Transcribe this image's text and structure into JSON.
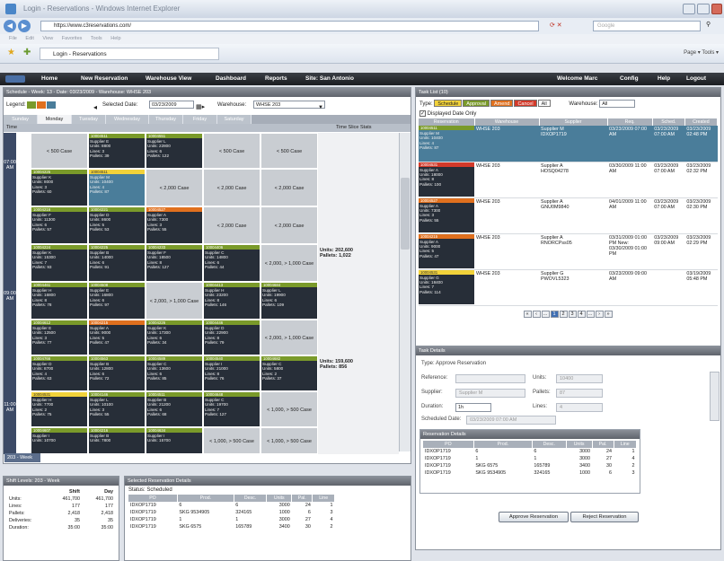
{
  "browser": {
    "title": "Login - Reservations - Windows Internet Explorer",
    "url": "https://www.c3reservations.com/",
    "search_placeholder": "Google",
    "menus": [
      "File",
      "Edit",
      "View",
      "Favorites",
      "Tools",
      "Help"
    ],
    "tab_label": "Login - Reservations",
    "tools": "Page ▾  Tools ▾"
  },
  "nav": {
    "home": "Home",
    "new_reservation": "New Reservation",
    "warehouse_view": "Warehouse View",
    "dashboard": "Dashboard",
    "reports": "Reports",
    "site": "Site: San Antonio",
    "welcome": "Welcome Marc",
    "config": "Config",
    "help": "Help",
    "logout": "Logout"
  },
  "schedule": {
    "header": "Schedule - Week: 13 - Date: 03/23/2009 - Warehouse: WHSE 203",
    "legend_label": "Legend:",
    "selected_date_label": "Selected Date:",
    "selected_date": "03/23/2009",
    "warehouse_label": "Warehouse:",
    "warehouse": "WHSE 203",
    "days": [
      "Sunday",
      "Monday",
      "Tuesday",
      "Wednesday",
      "Thursday",
      "Friday",
      "Saturday"
    ],
    "time_label": "Time",
    "stats_label": "Time Slice Stats",
    "week_button": "203 - Week",
    "times": [
      "07:00 AM",
      "09:00 AM",
      "11:00 AM"
    ],
    "empty": {
      "c500": "< 500 Case",
      "c2000": "< 2,000 Case",
      "c2000_1000": "< 2,000, > 1,000 Case",
      "c1000_500": "< 1,000, > 500 Case"
    },
    "stats": [
      {
        "units": "Units: 202,600",
        "pallets": "Pallets: 1,022"
      },
      {
        "units": "Units: 159,600",
        "pallets": "Pallets: 856"
      }
    ]
  },
  "shift": {
    "header": "Shift Levels: 203 - Week",
    "col1": "Shift",
    "col2": "Day",
    "rows": [
      [
        "Units:",
        "461,700",
        "461,700"
      ],
      [
        "Lines:",
        "177",
        "177"
      ],
      [
        "Pallets:",
        "2,418",
        "2,418"
      ],
      [
        "Deliveries:",
        "35",
        "35"
      ],
      [
        "Duration:",
        "35:00",
        "35:00"
      ]
    ]
  },
  "srd": {
    "header": "Selected Reservation Details",
    "status_label": "Status:",
    "status": "Scheduled",
    "cols": [
      "PO",
      "Prod.",
      "Desc.",
      "Units",
      "Pal.",
      "Line"
    ],
    "rows": [
      [
        "IDXOP1719",
        "6",
        "6",
        "3000",
        "24",
        "1"
      ],
      [
        "IDXOP1719",
        "SKG 9534905",
        "324165",
        "1000",
        "6",
        "3"
      ],
      [
        "IDXOP1719",
        "1",
        "1",
        "3000",
        "27",
        "4"
      ],
      [
        "IDXOP1719",
        "SKG 6575",
        "165789",
        "3400",
        "30",
        "2"
      ]
    ]
  },
  "tasklist": {
    "header": "Task List (10)",
    "type_label": "Type:",
    "chips": {
      "schedule": "Schedule",
      "approval": "Approval",
      "amend": "Amend",
      "cancel": "Cancel",
      "all": "All"
    },
    "warehouse_label": "Warehouse:",
    "warehouse": "All",
    "displayed_date_only": "Displayed Date Only",
    "cols": [
      "Reservation",
      "Warehouse",
      "Supplier",
      "Req.",
      "Sched.",
      "Created"
    ],
    "rows": [
      {
        "id": "10004511",
        "supplier": "Supplier M",
        "units": "Units: 10400",
        "lines": "Lines: 4",
        "pallets": "Pallets: 87",
        "wh": "WHSE 203",
        "sup": "Supplier M",
        "po": "IDXOP1719",
        "req": "03/23/2009 07:00 AM",
        "sched": "03/23/2009 07:00 AM",
        "created": "03/23/2009 02:48 PM"
      },
      {
        "id": "10004531",
        "supplier": "Supplier A",
        "units": "Units: 18000",
        "lines": "Lines: 8",
        "pallets": "Pallets: 100",
        "wh": "WHSE 203",
        "sup": "Supplier A",
        "po": "HOSQ04278",
        "req": "03/30/2009 11:00 AM",
        "sched": "03/23/2009 07:00 AM",
        "created": "03/23/2009 02:32 PM"
      },
      {
        "id": "10004527",
        "supplier": "Supplier A",
        "units": "Units: 7300",
        "lines": "Lines: 3",
        "pallets": "Pallets: 55",
        "wh": "WHSE 203",
        "sup": "Supplier A",
        "po": "GNU0M9840",
        "req": "04/01/2009 11:00 AM",
        "sched": "03/23/2009 07:00 AM",
        "created": "03/23/2009 02:30 PM"
      },
      {
        "id": "10004215",
        "supplier": "Supplier A",
        "units": "Units: 9000",
        "lines": "Lines: 5",
        "pallets": "Pallets: 47",
        "wh": "WHSE 203",
        "sup": "Supplier A",
        "po": "RNORCPss05",
        "req": "03/31/2009 01:00 PM New: 03/30/2009 01:00 PM",
        "sched": "03/23/2009 09:00 AM",
        "created": "03/23/2009 02:29 PM"
      },
      {
        "id": "10004531",
        "supplier": "Supplier G",
        "units": "Units: 18400",
        "lines": "Lines: 7",
        "pallets": "Pallets: 114",
        "wh": "WHSE 203",
        "sup": "Supplier G",
        "po": "PWOVL5323",
        "req": "03/23/2009 09:00 AM",
        "sched": "",
        "created": "03/19/2009 05:48 PM"
      }
    ],
    "pages": [
      "1",
      "2",
      "3",
      "4"
    ]
  },
  "taskdetails": {
    "header": "Task Details",
    "type": "Type:  Approve Reservation",
    "reference_label": "Reference:",
    "units_label": "Units:",
    "units": "10400",
    "supplier_label": "Supplier:",
    "supplier": "Supplier M",
    "pallets_label": "Pallets:",
    "pallets": "87",
    "duration_label": "Duration:",
    "duration": "1h",
    "lines_label": "Lines:",
    "lines": "4",
    "sched_label": "Scheduled Date:",
    "sched": "03/23/2009 07:00 AM"
  },
  "resdetails": {
    "header": "Reservation Details",
    "cols": [
      "PO",
      "Prod.",
      "Desc.",
      "Units",
      "Pal.",
      "Line"
    ],
    "rows": [
      [
        "IDXOP1719",
        "6",
        "6",
        "3000",
        "24",
        "1"
      ],
      [
        "IDXOP1719",
        "1",
        "1",
        "3000",
        "27",
        "4"
      ],
      [
        "IDXOP1719",
        "SKG 6575",
        "165789",
        "3400",
        "30",
        "2"
      ],
      [
        "IDXOP1719",
        "SKG 9534905",
        "324165",
        "1000",
        "6",
        "3"
      ]
    ],
    "approve": "Approve Reservation",
    "reject": "Reject Reservation"
  },
  "colors": {
    "green": "#7a9a2a",
    "orange": "#e0701e",
    "yellow": "#f2d23a",
    "red": "#d23a2a",
    "blue": "#2c5f9e",
    "teal": "#4a7d9a"
  }
}
